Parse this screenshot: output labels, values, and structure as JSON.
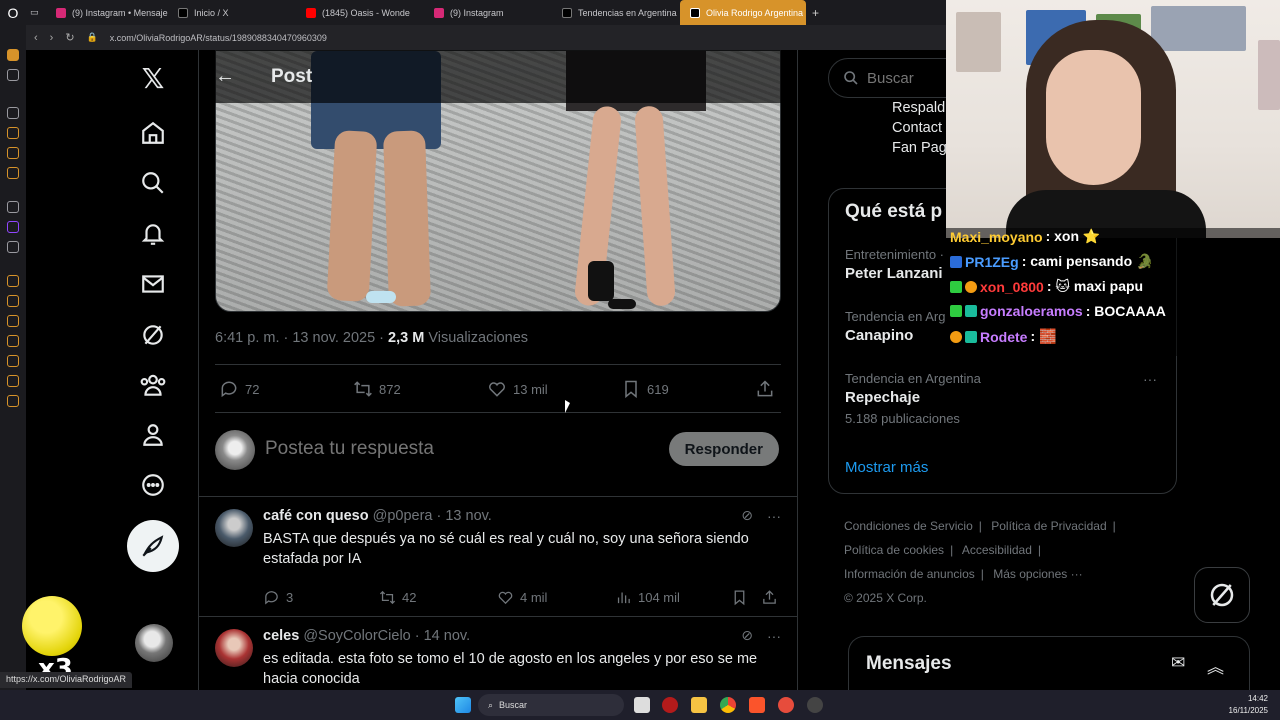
{
  "browser": {
    "tabs": [
      {
        "label": "(9) Instagram • Mensajes",
        "fav": "#d62976"
      },
      {
        "label": "Inicio / X",
        "fav": "#000000"
      },
      {
        "label": "(1845) Oasis - Wonde",
        "fav": "#ff0000"
      },
      {
        "label": "(9) Instagram",
        "fav": "#d62976"
      },
      {
        "label": "Tendencias en Argentina",
        "fav": "#000000"
      },
      {
        "label": "Olivia Rodrigo Argentina",
        "fav": "#000000"
      }
    ],
    "url": "x.com/OliviaRodrigoAR/status/1989088340470960309",
    "status_url": "https://x.com/OliviaRodrigoAR",
    "accent": "#d7932a"
  },
  "header": {
    "title": "Post"
  },
  "post": {
    "timestamp": "6:41 p. m. · 13 nov. 2025 · ",
    "views": "2,3 M",
    "views_label": " Visualizaciones",
    "replies": "72",
    "reposts": "872",
    "likes": "13 mil",
    "bookmarks": "619"
  },
  "reply_box": {
    "placeholder": "Postea tu respuesta",
    "button": "Responder"
  },
  "replies": [
    {
      "name": "café con queso",
      "handle": "@p0pera · 13 nov.",
      "text": "BASTA que después ya no sé cuál es real y cuál no, soy una señora siendo estafada por IA",
      "replies": "3",
      "reposts": "42",
      "likes": "4 mil",
      "views": "104 mil"
    },
    {
      "name": "celes",
      "handle": "@SoyColorCielo · 14 nov.",
      "text": "es editada. esta foto se tomo el 10 de agosto en los angeles y por eso se me hacia conocida"
    }
  ],
  "sidebar": {
    "search_placeholder": "Buscar",
    "partial_links": [
      "Respald",
      "Contact",
      "Fan Pag"
    ],
    "trends_title": "Qué está p",
    "trends": [
      {
        "category": "Entretenimiento ·",
        "name": "Peter Lanzani",
        "count": ""
      },
      {
        "category": "Tendencia en Arg",
        "name": "Canapino",
        "count": ""
      },
      {
        "category": "Tendencia en Argentina",
        "name": "Repechaje",
        "count": "5.188 publicaciones"
      }
    ],
    "show_more": "Mostrar más",
    "footer": [
      "Condiciones de Servicio",
      "|",
      "Política de Privacidad",
      "|",
      "Política de cookies",
      "|",
      "Accesibilidad",
      "|",
      "Información de anuncios",
      "|",
      "Más opciones ···",
      "© 2025 X Corp."
    ],
    "messages_title": "Mensajes"
  },
  "stream_chat": [
    {
      "user": "Maxi_moyano",
      "msg": ": xon ⭐"
    },
    {
      "user": "PR1ZEg",
      "msg": ": cami pensando 🐊"
    },
    {
      "user": "xon_0800",
      "msg": ": 🐱 maxi papu"
    },
    {
      "user": "gonzaloeramos",
      "msg": ": BOCAAAA"
    },
    {
      "user": "Rodete",
      "msg": ": 🧱"
    }
  ],
  "emote": {
    "counter": "x3"
  },
  "taskbar": {
    "search": "Buscar",
    "time": "14:42",
    "date": "16/11/2025"
  }
}
